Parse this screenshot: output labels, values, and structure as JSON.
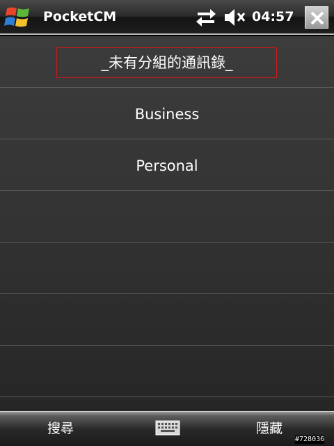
{
  "titlebar": {
    "title": "PocketCM",
    "time": "04:57",
    "icons": [
      "windows-start-icon",
      "connectivity-arrows-icon",
      "speaker-muted-icon",
      "close-icon"
    ]
  },
  "list": {
    "items": [
      {
        "label": "_未有分組的通訊錄_",
        "selected": true
      },
      {
        "label": "Business",
        "selected": false
      },
      {
        "label": "Personal",
        "selected": false
      }
    ]
  },
  "softkeys": {
    "left": "搜尋",
    "right": "隱藏",
    "center_icon": "keyboard-icon"
  },
  "watermark": "#728036",
  "colors": {
    "selection_border": "#d01818",
    "background": "#353535",
    "text": "#ffffff"
  }
}
